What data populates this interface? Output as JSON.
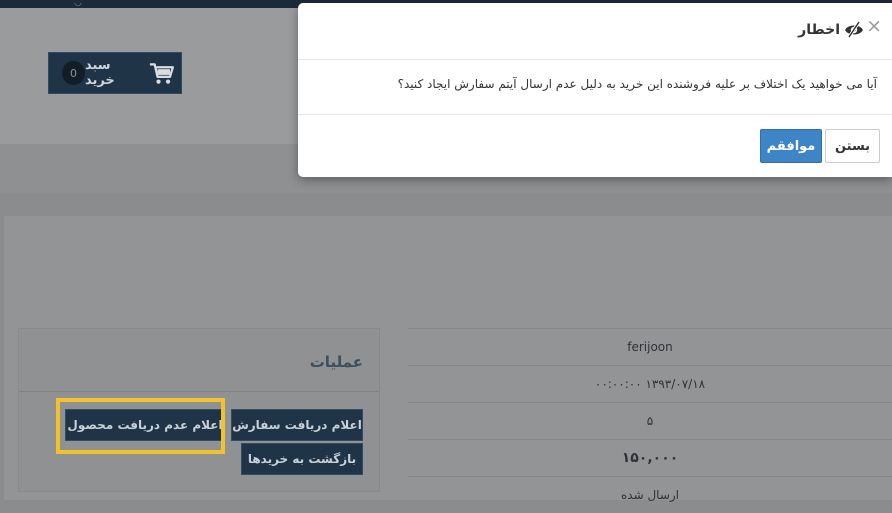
{
  "header": {
    "cart": {
      "label": "سبد خرید",
      "count": "0",
      "icon": "shopping-cart-icon"
    }
  },
  "operations": {
    "title": "عملیات",
    "buttons": {
      "order_received": "اعلام دریافت سفارش",
      "not_received": "اعلام عدم دریافت محصول",
      "back_to_purchases": "بازگشت به خریدها"
    }
  },
  "info_rows": [
    "ferijoon",
    "۰۰:۰۰:۰۰ ۱۳۹۳/۰۷/۱۸",
    "۵",
    "۱۵۰,۰۰۰",
    "ارسال شده"
  ],
  "modal": {
    "title": "اخطار",
    "message": "آیا می خواهید یک اختلاف بر علیه فروشنده این خرید به دلیل عدم ارسال آیتم سفارش ایجاد کنید؟",
    "close_label": "بستن",
    "confirm_label": "موافقم",
    "close_icon": "×"
  },
  "colors": {
    "highlight": "#f2c12e",
    "primary_button": "#3d85c6",
    "dark_button": "#1f3547"
  }
}
